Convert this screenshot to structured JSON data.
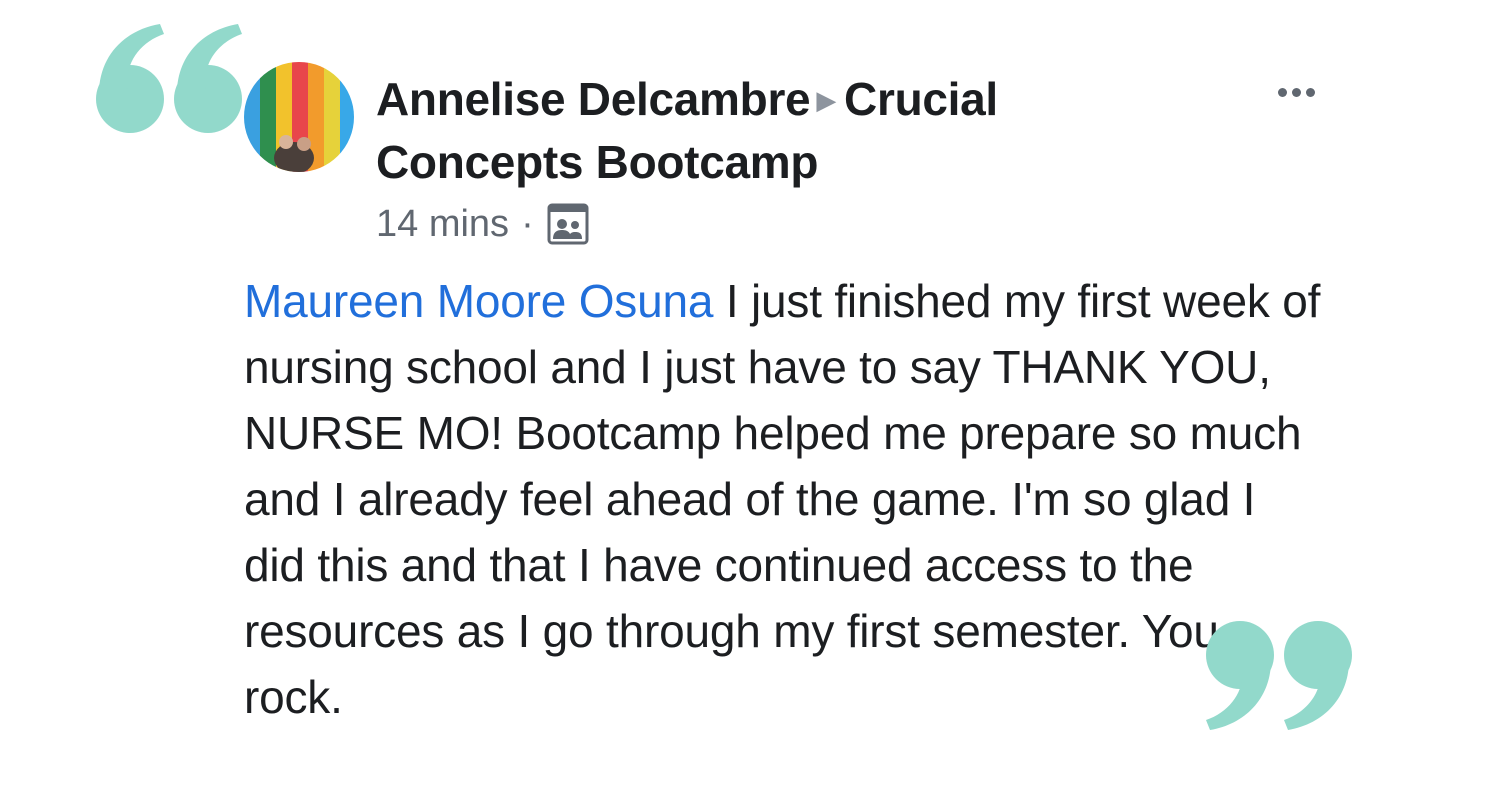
{
  "post": {
    "author": "Annelise Delcambre",
    "group": "Crucial Concepts Bootcamp",
    "time": "14 mins",
    "separator": "·",
    "mention": "Maureen Moore Osuna",
    "body": "I just finished my first week of nursing school and I just have to say THANK YOU, NURSE MO! Bootcamp helped me prepare so much and I already feel ahead of the game. I'm so glad I did this and that I have continued access to the resources as I go through my first semester. You rock."
  },
  "icons": {
    "arrow": "▶",
    "audience": "group-icon",
    "more": "more-options-icon"
  },
  "colors": {
    "quote_marks": "#92d9cb",
    "mention": "#216fdb",
    "text": "#1c1e21",
    "meta": "#606770"
  }
}
